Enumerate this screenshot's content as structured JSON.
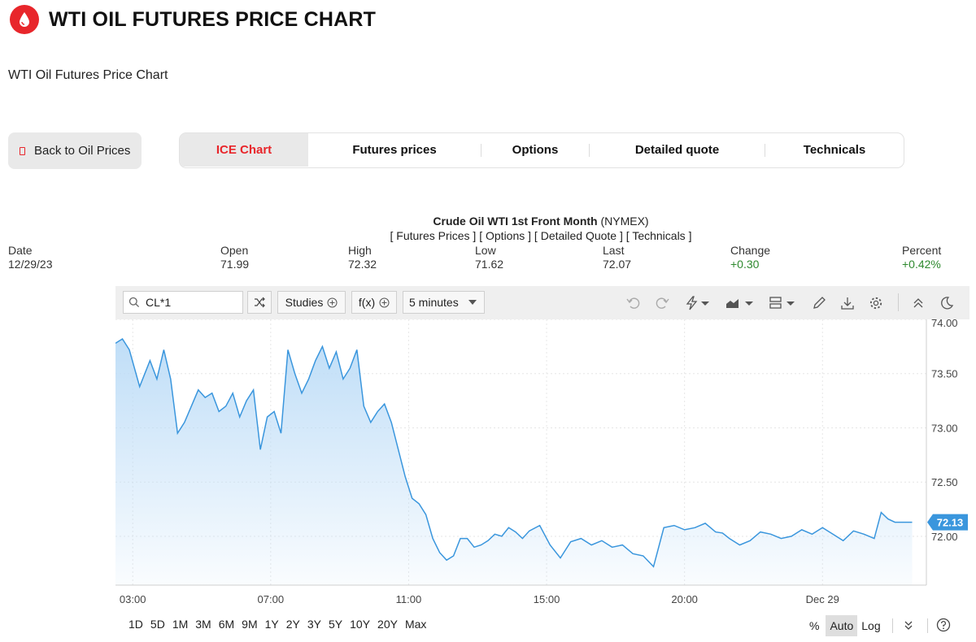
{
  "header": {
    "title": "WTI OIL FUTURES PRICE CHART",
    "subtitle": "WTI Oil Futures Price Chart",
    "brand_color": "#e8262b"
  },
  "nav": {
    "back_label": "Back to Oil Prices",
    "tabs": [
      {
        "label": "ICE Chart",
        "active": true
      },
      {
        "label": "Futures prices",
        "active": false
      },
      {
        "label": "Options",
        "active": false
      },
      {
        "label": "Detailed quote",
        "active": false
      },
      {
        "label": "Technicals",
        "active": false
      }
    ]
  },
  "quote": {
    "name": "Crude Oil WTI 1st Front Month",
    "exchange": "(NYMEX)",
    "links": [
      "Futures Prices",
      "Options",
      "Detailed Quote",
      "Technicals"
    ],
    "stats": [
      {
        "label": "Date",
        "value": "12/29/23"
      },
      {
        "label": "Open",
        "value": "71.99"
      },
      {
        "label": "High",
        "value": "72.32"
      },
      {
        "label": "Low",
        "value": "71.62"
      },
      {
        "label": "Last",
        "value": "72.07"
      },
      {
        "label": "Change",
        "value": "+0.30"
      },
      {
        "label": "Percent",
        "value": "+0.42%"
      }
    ],
    "positive_color": "#2f8a2f"
  },
  "toolbar": {
    "symbol": "CL*1",
    "studies_label": "Studies",
    "fx_label": "f(x)",
    "interval_label": "5 minutes",
    "icons": [
      "undo-icon",
      "redo-icon",
      "lightning-icon",
      "area-chart-icon",
      "layout-icon",
      "pencil-icon",
      "download-icon",
      "gear-icon",
      "collapse-icon",
      "moon-icon"
    ]
  },
  "chart_data": {
    "type": "area",
    "line_color": "#3a96dd",
    "grid": true,
    "ylim": [
      71.55,
      74.0
    ],
    "yticks": [
      "74.00",
      "73.50",
      "73.00",
      "72.50",
      "72.00"
    ],
    "ytick_values": [
      74.0,
      73.5,
      73.0,
      72.5,
      72.0
    ],
    "xticks": [
      "03:00",
      "07:00",
      "11:00",
      "15:00",
      "20:00",
      "Dec 29"
    ],
    "xtick_values": [
      0.5,
      4.5,
      8.5,
      12.5,
      16.5,
      20.5
    ],
    "last_price_label": "72.13",
    "x": [
      0,
      0.2,
      0.4,
      0.7,
      1.0,
      1.2,
      1.4,
      1.6,
      1.8,
      2.0,
      2.2,
      2.4,
      2.6,
      2.8,
      3.0,
      3.2,
      3.4,
      3.6,
      3.8,
      4.0,
      4.2,
      4.4,
      4.6,
      4.8,
      5.0,
      5.2,
      5.4,
      5.6,
      5.8,
      6.0,
      6.2,
      6.4,
      6.6,
      6.8,
      7.0,
      7.2,
      7.4,
      7.6,
      7.8,
      8.0,
      8.2,
      8.4,
      8.6,
      8.8,
      9.0,
      9.2,
      9.4,
      9.6,
      9.8,
      10.0,
      10.2,
      10.4,
      10.6,
      10.8,
      11.0,
      11.2,
      11.4,
      11.6,
      11.8,
      12.0,
      12.3,
      12.6,
      12.9,
      13.2,
      13.5,
      13.8,
      14.1,
      14.4,
      14.7,
      15.0,
      15.3,
      15.6,
      15.9,
      16.2,
      16.5,
      16.8,
      17.1,
      17.4,
      17.6,
      17.8,
      18.1,
      18.4,
      18.7,
      19.0,
      19.3,
      19.6,
      19.9,
      20.2,
      20.5,
      20.8,
      21.1,
      21.4,
      21.7,
      22.0,
      22.2,
      22.4,
      22.6,
      22.8,
      23.0,
      23.1
    ],
    "y": [
      73.78,
      73.82,
      73.72,
      73.38,
      73.62,
      73.45,
      73.72,
      73.45,
      72.95,
      73.05,
      73.2,
      73.35,
      73.28,
      73.32,
      73.15,
      73.2,
      73.32,
      73.1,
      73.25,
      73.35,
      72.8,
      73.1,
      73.15,
      72.95,
      73.72,
      73.5,
      73.32,
      73.45,
      73.62,
      73.75,
      73.55,
      73.7,
      73.45,
      73.55,
      73.72,
      73.2,
      73.05,
      73.15,
      73.22,
      73.05,
      72.8,
      72.55,
      72.35,
      72.3,
      72.2,
      71.98,
      71.85,
      71.78,
      71.82,
      71.98,
      71.98,
      71.9,
      71.92,
      71.96,
      72.02,
      72.0,
      72.08,
      72.04,
      71.98,
      72.05,
      72.1,
      71.92,
      71.8,
      71.95,
      71.98,
      71.92,
      71.96,
      71.9,
      71.92,
      71.84,
      71.82,
      71.72,
      72.08,
      72.1,
      72.06,
      72.08,
      72.12,
      72.04,
      72.03,
      71.98,
      71.92,
      71.96,
      72.04,
      72.02,
      71.98,
      72.0,
      72.06,
      72.02,
      72.08,
      72.02,
      71.96,
      72.05,
      72.02,
      71.98,
      72.22,
      72.16,
      72.13,
      72.13,
      72.13,
      72.13
    ]
  },
  "bottom": {
    "ranges": [
      "1D",
      "5D",
      "1M",
      "3M",
      "6M",
      "9M",
      "1Y",
      "2Y",
      "3Y",
      "5Y",
      "10Y",
      "20Y",
      "Max"
    ],
    "percent_label": "%",
    "auto_label": "Auto",
    "log_label": "Log",
    "collapse_glyph": "⌄"
  }
}
